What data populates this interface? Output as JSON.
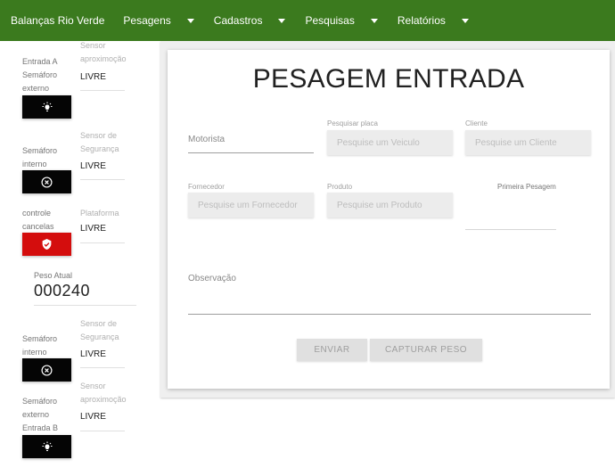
{
  "nav": {
    "brand": "Balanças Rio Verde",
    "menu": [
      {
        "label": "Pesagens"
      },
      {
        "label": "Cadastros"
      },
      {
        "label": "Pesquisas"
      },
      {
        "label": "Relatórios"
      }
    ]
  },
  "sidebar": {
    "entrada_a": {
      "line1": "Entrada A",
      "line2": "Semáforo",
      "line3": "externo",
      "sensor_label1": "Sensor",
      "sensor_label2": "aproximoção",
      "value": "LIVRE",
      "button_icon": "lightbulb-icon"
    },
    "seguranca_1": {
      "line1": "Semáforo",
      "line2": "interno",
      "sensor_label1": "Sensor de",
      "sensor_label2": "Segurança",
      "value": "LIVRE",
      "button_icon": "close-circle-icon"
    },
    "plataforma": {
      "line1": "controle",
      "line2": "cancelas",
      "sensor_label1": "Plataforma",
      "value": "LIVRE",
      "button_icon": "shield-check-icon"
    },
    "peso": {
      "label": "Peso Atual",
      "value": "000240"
    },
    "seguranca_2": {
      "line1": "Semáforo",
      "line2": "interno",
      "sensor_label1": "Sensor de",
      "sensor_label2": "Segurança",
      "value": "LIVRE",
      "button_icon": "close-circle-icon"
    },
    "entrada_b": {
      "line1": "Semáforo",
      "line2": "externo",
      "line3": "Entrada B",
      "sensor_label1": "Sensor",
      "sensor_label2": "aproximoção",
      "value": "LIVRE",
      "button_icon": "lightbulb-icon"
    }
  },
  "form": {
    "title": "PESAGEM ENTRADA",
    "motorista": {
      "label": "Motorista"
    },
    "placa": {
      "label": "Pesquisar placa",
      "placeholder": "Pesquise um Veiculo"
    },
    "cliente": {
      "label": "Cliente",
      "placeholder": "Pesquise um Cliente"
    },
    "fornecedor": {
      "label": "Fornecedor",
      "placeholder": "Pesquise um Fornecedor"
    },
    "produto": {
      "label": "Produto",
      "placeholder": "Pesquise um Produto"
    },
    "primeira_pesagem": {
      "label": "Primeira Pesagem"
    },
    "observacao": {
      "label": "Observação"
    },
    "buttons": {
      "enviar": "ENVIAR",
      "capturar": "CAPTURAR PESO"
    }
  },
  "colors": {
    "navbar": "#3b7a1e",
    "danger": "#d40d0d",
    "signal": "#050505"
  }
}
